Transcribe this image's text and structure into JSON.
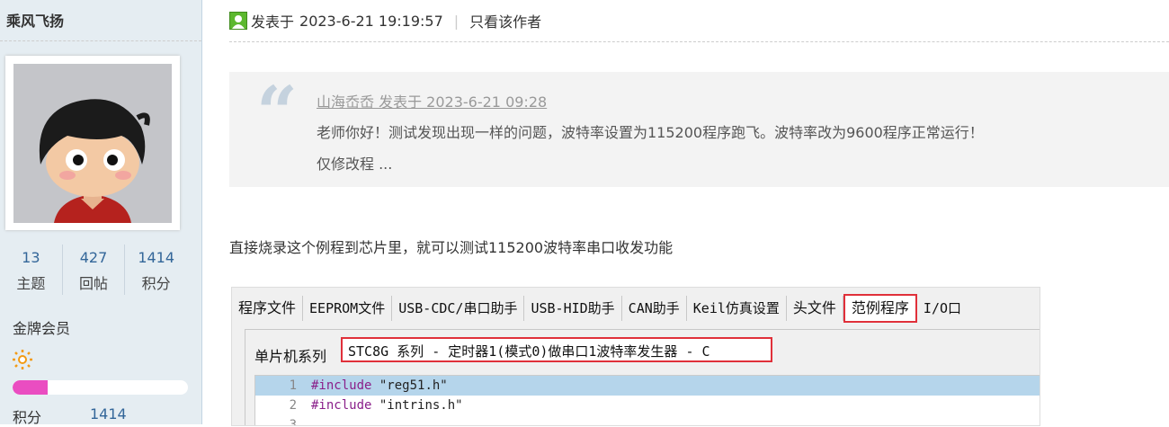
{
  "user": {
    "name": "乘风飞扬",
    "stats": [
      {
        "value": "13",
        "label": "主题"
      },
      {
        "value": "427",
        "label": "回帖"
      },
      {
        "value": "1414",
        "label": "积分"
      }
    ],
    "rank": "金牌会员",
    "progress_fraction": 0.2,
    "progress_color": "#ea4dc1",
    "credit_label": "积分",
    "credit_value": "1414"
  },
  "post": {
    "posted_prefix": "发表于",
    "posted_time": "2023-6-21 19:19:57",
    "separator": "|",
    "only_author": "只看该作者"
  },
  "quote": {
    "author_line": "山海岙岙 发表于 2023-6-21 09:28",
    "line1": "老师你好！测试发现出现一样的问题，波特率设置为115200程序跑飞。波特率改为9600程序正常运行！",
    "line2": "仅修改程 ..."
  },
  "body_text": "直接烧录这个例程到芯片里，就可以测试115200波特率串口收发功能",
  "screenshot": {
    "tabs": [
      {
        "label": "程序文件"
      },
      {
        "label": "EEPROM文件"
      },
      {
        "label": "USB-CDC/串口助手"
      },
      {
        "label": "USB-HID助手"
      },
      {
        "label": "CAN助手"
      },
      {
        "label": "Keil仿真设置"
      },
      {
        "label": "头文件"
      },
      {
        "label": "范例程序"
      },
      {
        "label": "I/O口"
      }
    ],
    "series_label": "单片机系列",
    "series_value": "STC8G 系列 - 定时器1(模式0)做串口1波特率发生器 - C",
    "code_lines": [
      {
        "num": "1",
        "kw": "#include",
        "rest": " \"reg51.h\""
      },
      {
        "num": "2",
        "kw": "#include",
        "rest": " \"intrins.h\""
      },
      {
        "num": "3",
        "kw": "",
        "rest": ""
      }
    ]
  }
}
